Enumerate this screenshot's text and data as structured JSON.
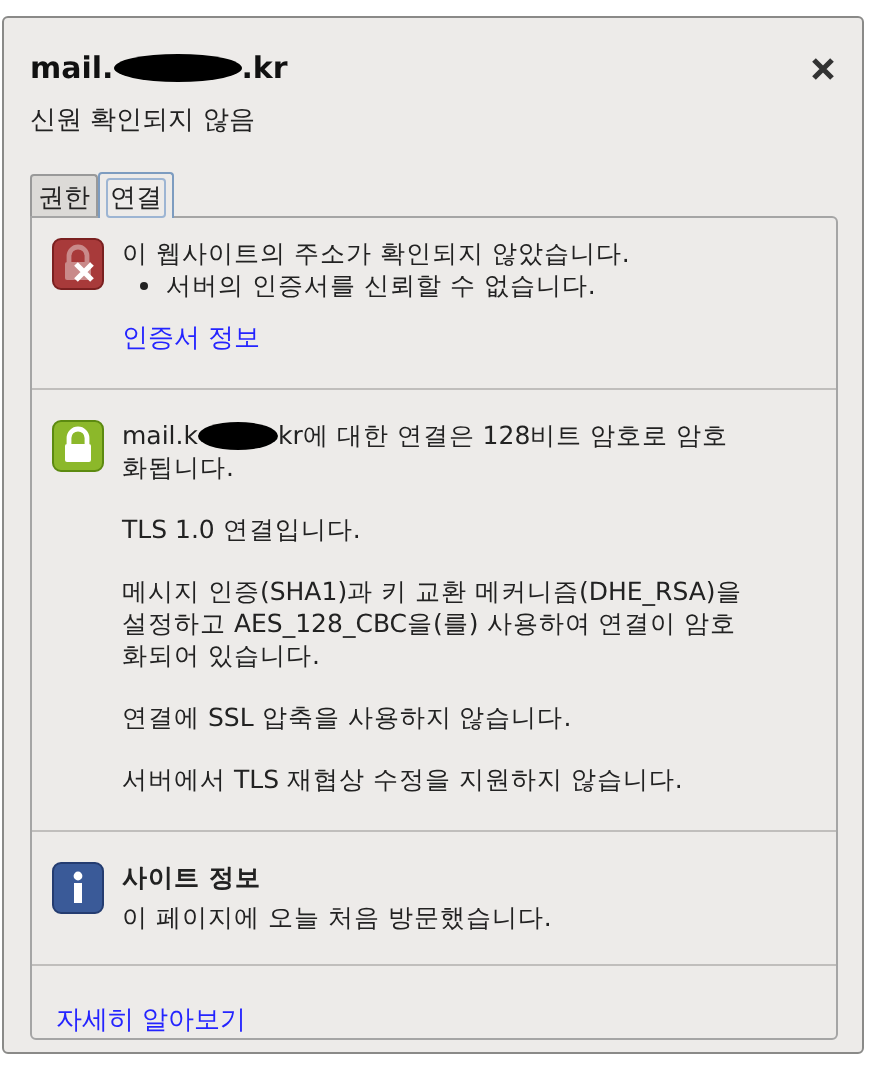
{
  "header": {
    "title_prefix": "mail.",
    "title_suffix": ".kr",
    "subtitle": "신원 확인되지 않음"
  },
  "tabs": [
    {
      "label": "권한",
      "selected": false
    },
    {
      "label": "연결",
      "selected": true
    }
  ],
  "sections": [
    {
      "kind": "identity",
      "heading": "이 웹사이트의 주소가 확인되지 않았습니다.",
      "bullets": [
        "서버의 인증서를 신뢰할 수 없습니다."
      ],
      "link": "인증서 정보"
    },
    {
      "kind": "encryption",
      "host_prefix": "mail.k",
      "text": "kr에 대한 연결은 128비트 암호로 암호",
      "text_continued": "화됩니다.",
      "paragraphs": [
        "TLS 1.0 연결입니다.",
        "메시지 인증(SHA1)과 키 교환 메커니즘(DHE_RSA)을 설정하고 AES_128_CBC을(를) 사용하여 연결이 암호화되어 있습니다.",
        "연결에 SSL 압축을 사용하지 않습니다.",
        "서버에서 TLS 재협상 수정을 지원하지 않습니다."
      ]
    },
    {
      "kind": "site",
      "heading": "사이트 정보",
      "text": "이 페이지에 오늘 처음 방문했습니다."
    }
  ],
  "footer_link": "자세히 알아보기"
}
